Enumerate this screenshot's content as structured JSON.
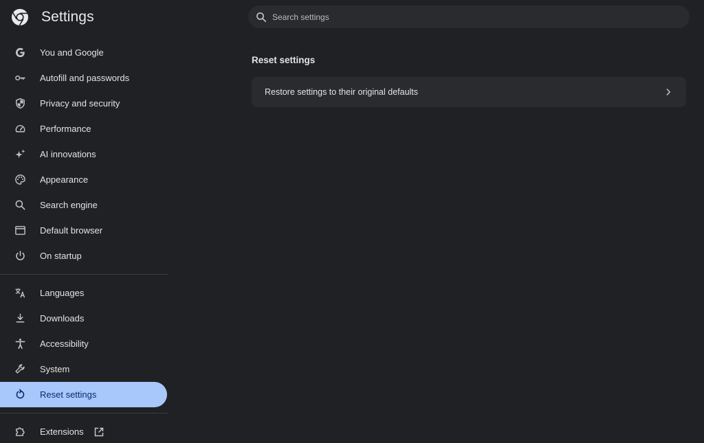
{
  "header": {
    "title": "Settings",
    "logo_icon": "chrome-logo-icon"
  },
  "search": {
    "placeholder": "Search settings",
    "value": ""
  },
  "sidebar": {
    "items": [
      {
        "label": "You and Google",
        "icon": "google-g-icon"
      },
      {
        "label": "Autofill and passwords",
        "icon": "key-icon"
      },
      {
        "label": "Privacy and security",
        "icon": "shield-icon"
      },
      {
        "label": "Performance",
        "icon": "speedometer-icon"
      },
      {
        "label": "AI innovations",
        "icon": "sparkle-icon"
      },
      {
        "label": "Appearance",
        "icon": "palette-icon"
      },
      {
        "label": "Search engine",
        "icon": "search-icon"
      },
      {
        "label": "Default browser",
        "icon": "browser-window-icon"
      },
      {
        "label": "On startup",
        "icon": "power-icon"
      }
    ],
    "items2": [
      {
        "label": "Languages",
        "icon": "translate-icon"
      },
      {
        "label": "Downloads",
        "icon": "download-icon"
      },
      {
        "label": "Accessibility",
        "icon": "accessibility-icon"
      },
      {
        "label": "System",
        "icon": "wrench-icon"
      },
      {
        "label": "Reset settings",
        "icon": "reset-icon",
        "active": true
      }
    ],
    "extensions": {
      "label": "Extensions",
      "icon": "puzzle-icon",
      "external_icon": "open-in-new-icon"
    }
  },
  "main": {
    "section_title": "Reset settings",
    "rows": [
      {
        "label": "Restore settings to their original defaults",
        "icon": "chevron-right-icon"
      }
    ]
  },
  "colors": {
    "background": "#202124",
    "surface": "#2a2b2e",
    "active_bg": "#a8c7fa",
    "active_text": "#062e6f",
    "text": "#e3e3e3"
  }
}
